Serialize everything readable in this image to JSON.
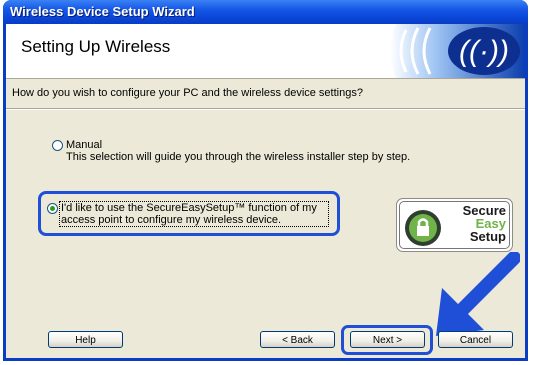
{
  "window": {
    "title": "Wireless Device Setup Wizard"
  },
  "header": {
    "title": "Setting Up Wireless"
  },
  "question": "How do you wish to configure your PC and the wireless device settings?",
  "options": [
    {
      "label": "Manual",
      "description": "This selection will guide you through the wireless installer step by step.",
      "selected": false
    },
    {
      "line1": "I'd like to use the SecureEasySetup™ function of my",
      "line2": "access point to configure my wireless device.",
      "selected": true
    }
  ],
  "logo": {
    "line1": "Secure",
    "line2": "Easy",
    "line3": "Setup"
  },
  "buttons": {
    "help": "Help",
    "back": "< Back",
    "next": "Next >",
    "cancel": "Cancel"
  },
  "colors": {
    "title_bar": "#0a46d8",
    "highlight": "#1f4fd6",
    "arrow": "#1f4fd6",
    "radio_dot": "#21a121"
  },
  "icons": {
    "banner": "wireless-signal-icon",
    "arrow": "pointer-arrow-icon",
    "logo": "secureeasysetup-lock-icon"
  }
}
